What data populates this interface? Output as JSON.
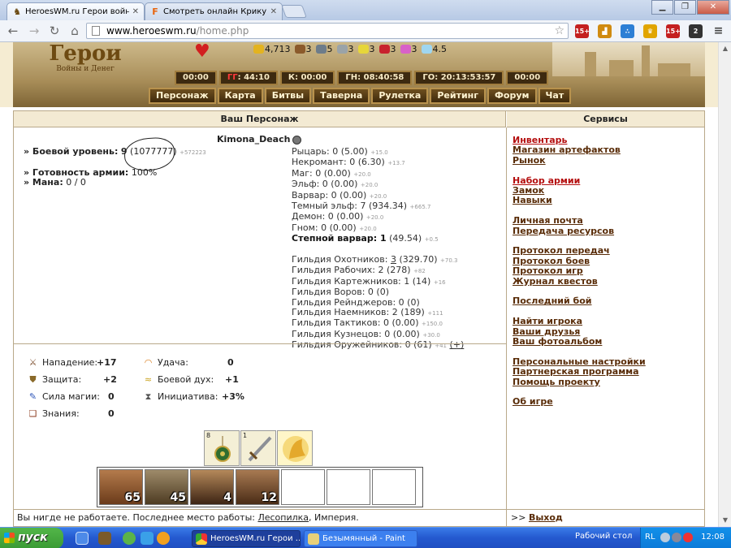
{
  "browser": {
    "tabs": [
      {
        "title": "HeroesWM.ru Герои войны",
        "active": true
      },
      {
        "title": "Смотреть онлайн Крикуны",
        "active": false
      }
    ],
    "url_host": "www.heroeswm.ru",
    "url_path": "/home.php"
  },
  "game": {
    "logo_title": "Герои",
    "logo_subtitle": "Войны и Денег",
    "resources": [
      {
        "icon": "gold-icon",
        "value": "4,713"
      },
      {
        "icon": "wood-icon",
        "value": "3"
      },
      {
        "icon": "ore-icon",
        "value": "5"
      },
      {
        "icon": "mercury-icon",
        "value": "3"
      },
      {
        "icon": "sulfur-icon",
        "value": "3"
      },
      {
        "icon": "crystal-icon",
        "value": "3"
      },
      {
        "icon": "gems-icon",
        "value": "3"
      },
      {
        "icon": "diamond-icon",
        "value": "4.5"
      }
    ],
    "clocks": [
      {
        "label": "00:00"
      },
      {
        "prefix": "ГГ",
        "label": ": 44:10"
      },
      {
        "label": "К: 00:00"
      },
      {
        "label": "ГН: 08:40:58"
      },
      {
        "label": "ГО: 20:13:53:57"
      },
      {
        "label": "00:00"
      }
    ],
    "menu": [
      "Персонаж",
      "Карта",
      "Битвы",
      "Таверна",
      "Рулетка",
      "Рейтинг",
      "Форум",
      "Чат"
    ]
  },
  "character": {
    "panel_title": "Ваш Персонаж",
    "name": "Kimona_Deach",
    "combat_level_label": "» Боевой уровень:",
    "combat_level": "9",
    "experience": "(1077777)",
    "experience_delta": "+572223",
    "army_ready_label": "» Готовность армии:",
    "army_ready": "100%",
    "mana_label": "» Мана:",
    "mana": "0 / 0",
    "factions": [
      {
        "text": "Рыцарь: 0 (5.00)",
        "delta": "+15.0",
        "bold": false
      },
      {
        "text": "Некромант: 0 (6.30)",
        "delta": "+13.7",
        "bold": false
      },
      {
        "text": "Маг: 0 (0.00)",
        "delta": "+20.0",
        "bold": false
      },
      {
        "text": "Эльф: 0 (0.00)",
        "delta": "+20.0",
        "bold": false
      },
      {
        "text": "Варвар: 0 (0.00)",
        "delta": "+20.0",
        "bold": false
      },
      {
        "text": "Темный эльф: 7 (934.34)",
        "delta": "+665.7",
        "bold": false
      },
      {
        "text": "Демон: 0 (0.00)",
        "delta": "+20.0",
        "bold": false
      },
      {
        "text": "Гном: 0 (0.00)",
        "delta": "+20.0",
        "bold": false
      },
      {
        "text": "Степной варвар: 1",
        "tail": " (49.54)",
        "delta": "+0.5",
        "bold": true
      }
    ],
    "guilds": [
      {
        "text": "Гильдия Охотников: ",
        "u": "3",
        "tail": " (329.70)",
        "delta": "+70.3"
      },
      {
        "text": "Гильдия Рабочих: 2 (278)",
        "delta": "+82"
      },
      {
        "text": "Гильдия Картежников: 1 (14)",
        "delta": "+16"
      },
      {
        "text": "Гильдия Воров: 0 (0)",
        "delta": ""
      },
      {
        "text": "Гильдия Рейнджеров: 0 (0)",
        "delta": ""
      },
      {
        "text": "Гильдия Наемников: 2 (189)",
        "delta": "+111"
      },
      {
        "text": "Гильдия Тактиков: 0 (0.00)",
        "delta": "+150.0"
      },
      {
        "text": "Гильдия Кузнецов: 0 (0.00)",
        "delta": "+30.0"
      },
      {
        "text": "Гильдия Оружейников: 0 (61)",
        "delta": "+41",
        "link": "(+)"
      }
    ],
    "attributes": {
      "attack_label": "Нападение:",
      "attack": "+17",
      "defense_label": "Защита:",
      "defense": "+2",
      "spellpower_label": "Сила магии:",
      "spellpower": "0",
      "knowledge_label": "Знания:",
      "knowledge": "0",
      "luck_label": "Удача:",
      "luck": "0",
      "morale_label": "Боевой дух:",
      "morale": "+1",
      "initiative_label": "Инициатива:",
      "initiative": "+3%"
    },
    "artifacts": [
      {
        "count": "8",
        "icon": "amulet-icon"
      },
      {
        "count": "1",
        "icon": "sword-icon"
      },
      {
        "count": "",
        "icon": "horse-icon"
      }
    ],
    "army": [
      {
        "icon": "minotaur-icon",
        "count": "65"
      },
      {
        "icon": "dwarf-warrior-icon",
        "count": "45"
      },
      {
        "icon": "sorceress-icon",
        "count": "4"
      },
      {
        "icon": "orc-icon",
        "count": "12"
      },
      {
        "icon": "",
        "count": ""
      },
      {
        "icon": "",
        "count": ""
      },
      {
        "icon": "",
        "count": ""
      }
    ],
    "work_text": "Вы нигде не работаете. Последнее место работы: ",
    "work_place": "Лесопилка",
    "work_tail": ", Империя."
  },
  "services": {
    "panel_title": "Сервисы",
    "items": [
      {
        "label": "Инвентарь",
        "red": true
      },
      {
        "label": "Магазин артефактов"
      },
      {
        "label": "Рынок"
      },
      {
        "gap": true
      },
      {
        "label": "Набор армии",
        "red": true
      },
      {
        "label": "Замок"
      },
      {
        "label": "Навыки"
      },
      {
        "gap": true
      },
      {
        "label": "Личная почта"
      },
      {
        "label": "Передача ресурсов"
      },
      {
        "gap": true
      },
      {
        "label": "Протокол передач"
      },
      {
        "label": "Протокол боев"
      },
      {
        "label": "Протокол игр"
      },
      {
        "label": "Журнал квестов"
      },
      {
        "gap": true
      },
      {
        "label": "Последний бой"
      },
      {
        "gap": true
      },
      {
        "label": "Найти игрока"
      },
      {
        "label": "Ваши друзья"
      },
      {
        "label": "Ваш фотоальбом"
      },
      {
        "gap": true
      },
      {
        "label": "Персональные настройки"
      },
      {
        "label": "Партнерская программа"
      },
      {
        "label": "Помощь проекту"
      },
      {
        "gap": true
      },
      {
        "label": "Об игре"
      }
    ],
    "exit_prefix": ">> ",
    "exit_label": "Выход"
  },
  "taskbar": {
    "start_label": "пуск",
    "tasks": [
      {
        "title": "HeroesWM.ru Герои ...",
        "active": true
      },
      {
        "title": "Безымянный - Paint",
        "active": false
      }
    ],
    "desktop_label": "Рабочий стол",
    "lang": "RL",
    "time": "12:08"
  }
}
